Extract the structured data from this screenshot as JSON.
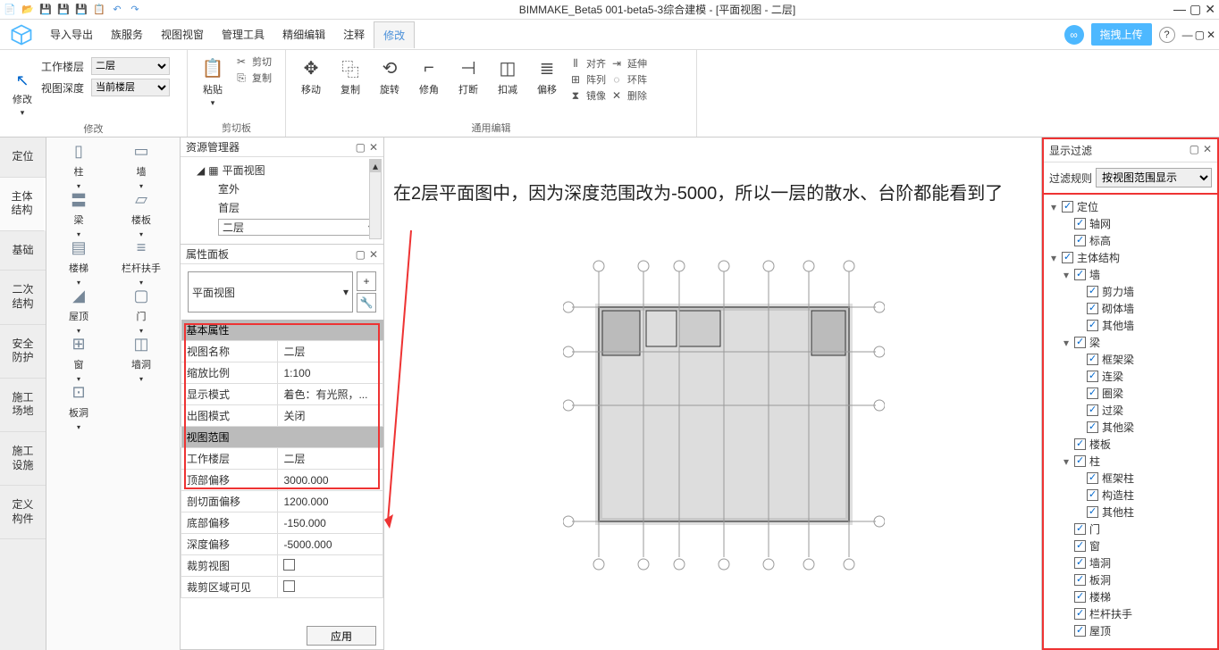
{
  "title": "BIMMAKE_Beta5 001-beta5-3综合建模 - [平面视图 - 二层]",
  "menus": [
    "导入导出",
    "族服务",
    "视图视窗",
    "管理工具",
    "精细编辑",
    "注释",
    "修改"
  ],
  "menu_active": 6,
  "upload_label": "拖拽上传",
  "ribbon": {
    "modify": {
      "label": "修改",
      "work_floor_label": "工作楼层",
      "work_floor": "二层",
      "view_depth_label": "视图深度",
      "view_depth": "当前楼层",
      "arrow": "修改"
    },
    "clipboard": {
      "label": "剪切板",
      "paste": "粘贴",
      "cut": "剪切",
      "copy": "复制"
    },
    "edit": {
      "label": "通用编辑",
      "move": "移动",
      "copy": "复制",
      "rotate": "旋转",
      "corner": "修角",
      "break": "打断",
      "trim": "扣减",
      "offset": "偏移",
      "align": "对齐",
      "array": "阵列",
      "mirror": "镜像",
      "extend": "延伸",
      "ring": "环阵",
      "delete": "删除"
    }
  },
  "left_tabs": [
    "定位",
    "主体\n结构",
    "基础",
    "二次\n结构",
    "安全\n防护",
    "施工\n场地",
    "施工\n设施",
    "定义\n构件"
  ],
  "left_tab_active": 1,
  "palette": [
    "柱",
    "墙",
    "梁",
    "楼板",
    "楼梯",
    "栏杆扶手",
    "屋顶",
    "门",
    "窗",
    "墙洞",
    "板洞"
  ],
  "resource_panel": {
    "title": "资源管理器",
    "root": "平面视图",
    "items": [
      "室外",
      "首层"
    ],
    "selected": "二层"
  },
  "prop_panel": {
    "title": "属性面板",
    "type": "平面视图",
    "section1": "基本属性",
    "rows1": [
      [
        "视图名称",
        "二层"
      ],
      [
        "缩放比例",
        "1:100"
      ],
      [
        "显示模式",
        "着色：有光照，..."
      ],
      [
        "出图模式",
        "关闭"
      ]
    ],
    "section2": "视图范围",
    "rows2": [
      [
        "工作楼层",
        "二层"
      ],
      [
        "顶部偏移",
        "3000.000"
      ],
      [
        "剖切面偏移",
        "1200.000"
      ],
      [
        "底部偏移",
        "-150.000"
      ],
      [
        "深度偏移",
        "-5000.000"
      ],
      [
        "裁剪视图",
        ""
      ],
      [
        "裁剪区域可见",
        ""
      ]
    ],
    "apply": "应用"
  },
  "annotation": "在2层平面图中，因为深度范围改为-5000，所以一层的散水、台阶都能看到了",
  "filter": {
    "title": "显示过滤",
    "rule_label": "过滤规则",
    "rule": "按视图范围显示"
  },
  "tree": [
    {
      "l": 0,
      "e": "▾",
      "t": "定位"
    },
    {
      "l": 1,
      "e": "",
      "t": "轴网"
    },
    {
      "l": 1,
      "e": "",
      "t": "标高"
    },
    {
      "l": 0,
      "e": "▾",
      "t": "主体结构"
    },
    {
      "l": 1,
      "e": "▾",
      "t": "墙"
    },
    {
      "l": 2,
      "e": "",
      "t": "剪力墙"
    },
    {
      "l": 2,
      "e": "",
      "t": "砌体墙"
    },
    {
      "l": 2,
      "e": "",
      "t": "其他墙"
    },
    {
      "l": 1,
      "e": "▾",
      "t": "梁"
    },
    {
      "l": 2,
      "e": "",
      "t": "框架梁"
    },
    {
      "l": 2,
      "e": "",
      "t": "连梁"
    },
    {
      "l": 2,
      "e": "",
      "t": "圈梁"
    },
    {
      "l": 2,
      "e": "",
      "t": "过梁"
    },
    {
      "l": 2,
      "e": "",
      "t": "其他梁"
    },
    {
      "l": 1,
      "e": "",
      "t": "楼板"
    },
    {
      "l": 1,
      "e": "▾",
      "t": "柱"
    },
    {
      "l": 2,
      "e": "",
      "t": "框架柱"
    },
    {
      "l": 2,
      "e": "",
      "t": "构造柱"
    },
    {
      "l": 2,
      "e": "",
      "t": "其他柱"
    },
    {
      "l": 1,
      "e": "",
      "t": "门"
    },
    {
      "l": 1,
      "e": "",
      "t": "窗"
    },
    {
      "l": 1,
      "e": "",
      "t": "墙洞"
    },
    {
      "l": 1,
      "e": "",
      "t": "板洞"
    },
    {
      "l": 1,
      "e": "",
      "t": "楼梯"
    },
    {
      "l": 1,
      "e": "",
      "t": "栏杆扶手"
    },
    {
      "l": 1,
      "e": "",
      "t": "屋顶"
    }
  ]
}
